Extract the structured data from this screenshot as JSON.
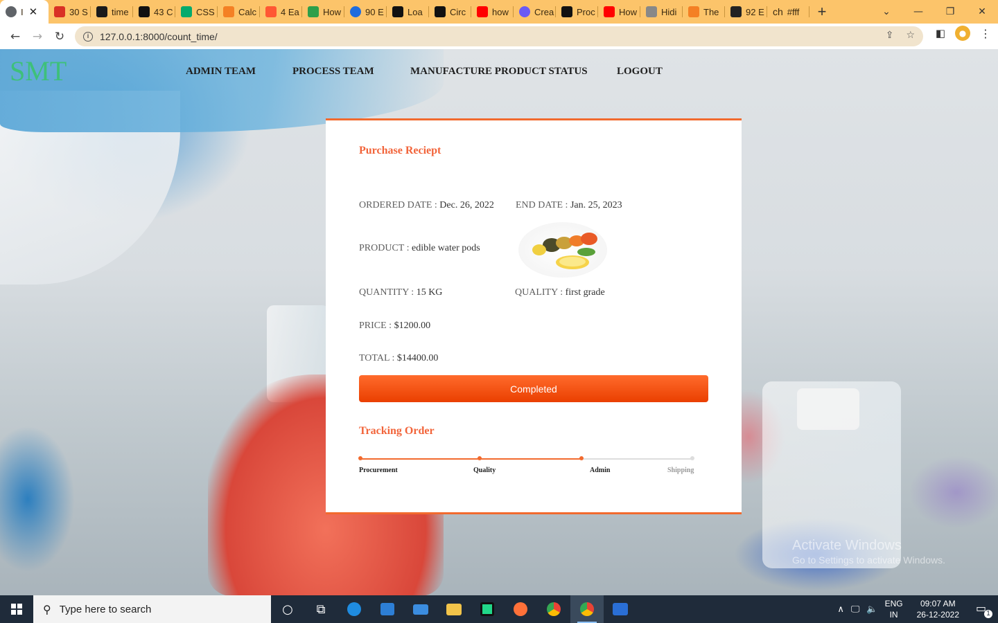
{
  "browser": {
    "tabs": [
      {
        "label": "I",
        "favicon_color": "#5f6368",
        "active": true
      },
      {
        "label": "30 S",
        "favicon_color": "#d93025"
      },
      {
        "label": "time",
        "favicon_color": "#1a1a1a"
      },
      {
        "label": "43 C",
        "favicon_color": "#111111"
      },
      {
        "label": "CSS",
        "favicon_color": "#04aa6d"
      },
      {
        "label": "Calc",
        "favicon_color": "#f48024"
      },
      {
        "label": "4 Ea",
        "favicon_color": "#ff5733"
      },
      {
        "label": "How",
        "favicon_color": "#2e9f4a"
      },
      {
        "label": "90 E",
        "favicon_color": "#1e6cdf"
      },
      {
        "label": "Loa",
        "favicon_color": "#111111"
      },
      {
        "label": "Circ",
        "favicon_color": "#111111"
      },
      {
        "label": "how",
        "favicon_color": "#ff0000"
      },
      {
        "label": "Crea",
        "favicon_color": "#6b5bf5"
      },
      {
        "label": "Proc",
        "favicon_color": "#111111"
      },
      {
        "label": "How",
        "favicon_color": "#ff0000"
      },
      {
        "label": "Hidi",
        "favicon_color": "#888888"
      },
      {
        "label": "The",
        "favicon_color": "#f48024"
      },
      {
        "label": "92 E",
        "favicon_color": "#222222"
      },
      {
        "label": "#fff",
        "favicon_color": "#222222",
        "prefix": "ch"
      }
    ],
    "url": "127.0.0.1:8000/count_time/"
  },
  "site": {
    "logo": "SMT",
    "nav": [
      "ADMIN TEAM",
      "PROCESS TEAM",
      "MANUFACTURE PRODUCT STATUS",
      "LOGOUT"
    ]
  },
  "receipt": {
    "title": "Purchase Reciept",
    "ordered_date_label": "ORDERED DATE : ",
    "ordered_date": "Dec. 26, 2022",
    "end_date_label": "END DATE : ",
    "end_date": "Jan. 25, 2023",
    "product_label": "PRODUCT : ",
    "product": "edible water pods",
    "quantity_label": "QUANTITY : ",
    "quantity": "15 KG",
    "quality_label": "QUALITY : ",
    "quality": "first grade",
    "price_label": "PRICE : ",
    "price": "$1200.00",
    "total_label": "TOTAL : ",
    "total": "$14400.00",
    "status": "Completed"
  },
  "tracking": {
    "title": "Tracking Order",
    "steps": [
      "Procurement",
      "Quality",
      "Admin",
      "Shipping"
    ],
    "completed_steps": 3,
    "accent": "#f26a2e"
  },
  "watermark": {
    "line1": "Activate Windows",
    "line2": "Go to Settings to activate Windows."
  },
  "taskbar": {
    "search_placeholder": "Type here to search",
    "lang": "ENG",
    "region": "IN",
    "time": "09:07 AM",
    "date": "26-12-2022",
    "notifications": "1"
  }
}
